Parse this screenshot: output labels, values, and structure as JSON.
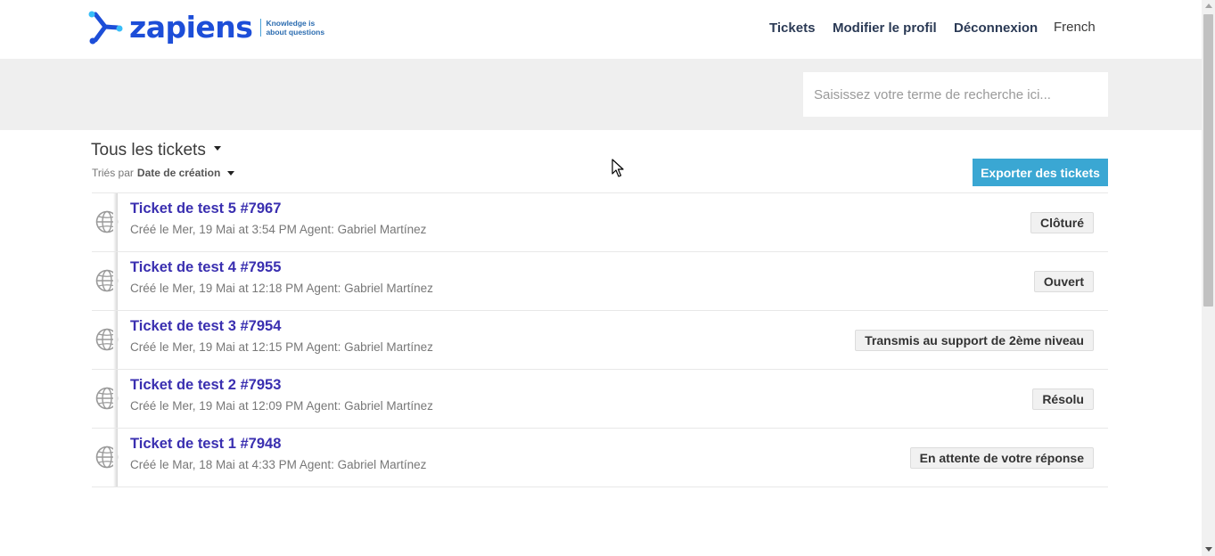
{
  "brand": {
    "name": "zapiens",
    "tagline_line1": "Knowledge is",
    "tagline_line2": "about questions"
  },
  "nav": {
    "tickets": "Tickets",
    "edit_profile": "Modifier le profil",
    "logout": "Déconnexion",
    "language": "French"
  },
  "search": {
    "placeholder": "Saisissez votre terme de recherche ici...",
    "value": ""
  },
  "list": {
    "title": "Tous les tickets",
    "sort_prefix": "Triés par",
    "sort_field": "Date de création",
    "export_label": "Exporter des tickets"
  },
  "tickets": [
    {
      "title": "Ticket de test 5 #7967",
      "meta": "Créé le Mer, 19 Mai at 3:54 PM Agent: Gabriel Martínez",
      "status": "Clôturé"
    },
    {
      "title": "Ticket de test 4 #7955",
      "meta": "Créé le Mer, 19 Mai at 12:18 PM Agent: Gabriel Martínez",
      "status": "Ouvert"
    },
    {
      "title": "Ticket de test 3 #7954",
      "meta": "Créé le Mer, 19 Mai at 12:15 PM Agent: Gabriel Martínez",
      "status": "Transmis au support de 2ème niveau"
    },
    {
      "title": "Ticket de test 2 #7953",
      "meta": "Créé le Mer, 19 Mai at 12:09 PM Agent: Gabriel Martínez",
      "status": "Résolu"
    },
    {
      "title": "Ticket de test 1 #7948",
      "meta": "Créé le Mar, 18 Mai at 4:33 PM Agent: Gabriel Martínez",
      "status": "En attente de votre réponse"
    }
  ],
  "icons": {
    "ticket_source": "globe-icon",
    "logo_mark": "zapiens-logo-icon"
  },
  "colors": {
    "brand_blue": "#1d4ed8",
    "nav_text": "#2b3a55",
    "ticket_title": "#3a2fb0",
    "export_button": "#3aa7d3",
    "search_band": "#efefef"
  }
}
